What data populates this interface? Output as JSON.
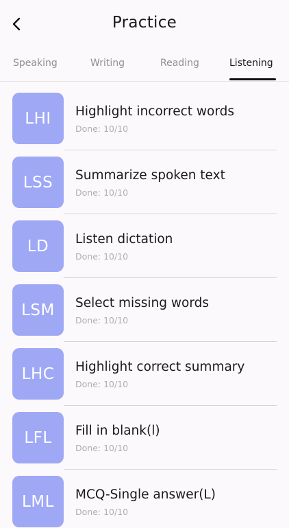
{
  "header": {
    "title": "Practice",
    "back_icon": "chevron-left-icon"
  },
  "tabs": [
    {
      "label": "Speaking",
      "active": false
    },
    {
      "label": "Writing",
      "active": false
    },
    {
      "label": "Reading",
      "active": false
    },
    {
      "label": "Listening",
      "active": true
    }
  ],
  "items": [
    {
      "abbr": "LHI",
      "title": "Highlight incorrect words",
      "status": "Done: 10/10"
    },
    {
      "abbr": "LSS",
      "title": "Summarize spoken text",
      "status": "Done: 10/10"
    },
    {
      "abbr": "LD",
      "title": "Listen dictation",
      "status": "Done: 10/10"
    },
    {
      "abbr": "LSM",
      "title": "Select missing words",
      "status": "Done: 10/10"
    },
    {
      "abbr": "LHC",
      "title": "Highlight correct summary",
      "status": "Done: 10/10"
    },
    {
      "abbr": "LFL",
      "title": "Fill in blank(l)",
      "status": "Done: 10/10"
    },
    {
      "abbr": "LML",
      "title": "MCQ-Single answer(L)",
      "status": "Done: 10/10"
    }
  ],
  "colors": {
    "tile": "#9fa8f5",
    "background": "#fbf9fb",
    "active_tab": "#1a1a1a",
    "inactive_tab": "#8f8d92"
  }
}
